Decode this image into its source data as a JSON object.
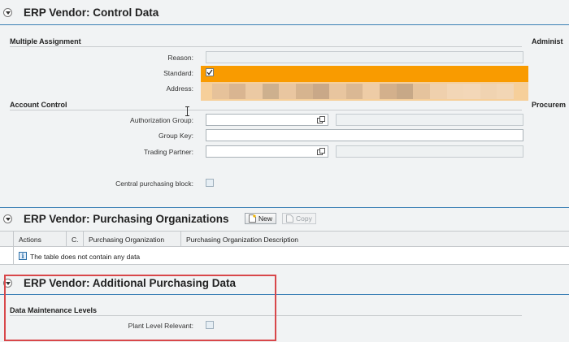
{
  "control_data": {
    "title": "ERP Vendor: Control Data",
    "multiple_assignment": {
      "header": "Multiple Assignment",
      "reason_label": "Reason:",
      "standard_label": "Standard:",
      "address_label": "Address:"
    },
    "right_header_1": "Administ",
    "account_control": {
      "header": "Account Control",
      "auth_group_label": "Authorization Group:",
      "group_key_label": "Group Key:",
      "trading_partner_label": "Trading Partner:",
      "central_block_label": "Central purchasing block:"
    },
    "right_header_2": "Procurem"
  },
  "purchasing_orgs": {
    "title": "ERP Vendor: Purchasing Organizations",
    "new_label": "New",
    "copy_label": "Copy",
    "columns": [
      "Actions",
      "C.",
      "Purchasing Organization",
      "Purchasing Organization Description"
    ],
    "empty_text": "The table does not contain any data"
  },
  "additional_data": {
    "title": "ERP Vendor: Additional Purchasing Data",
    "header": "Data Maintenance Levels",
    "plant_label": "Plant Level Relevant:"
  },
  "colors": {
    "highlight": "#f99b00",
    "accent": "#3a7fb5",
    "annotation": "#d8474a"
  }
}
